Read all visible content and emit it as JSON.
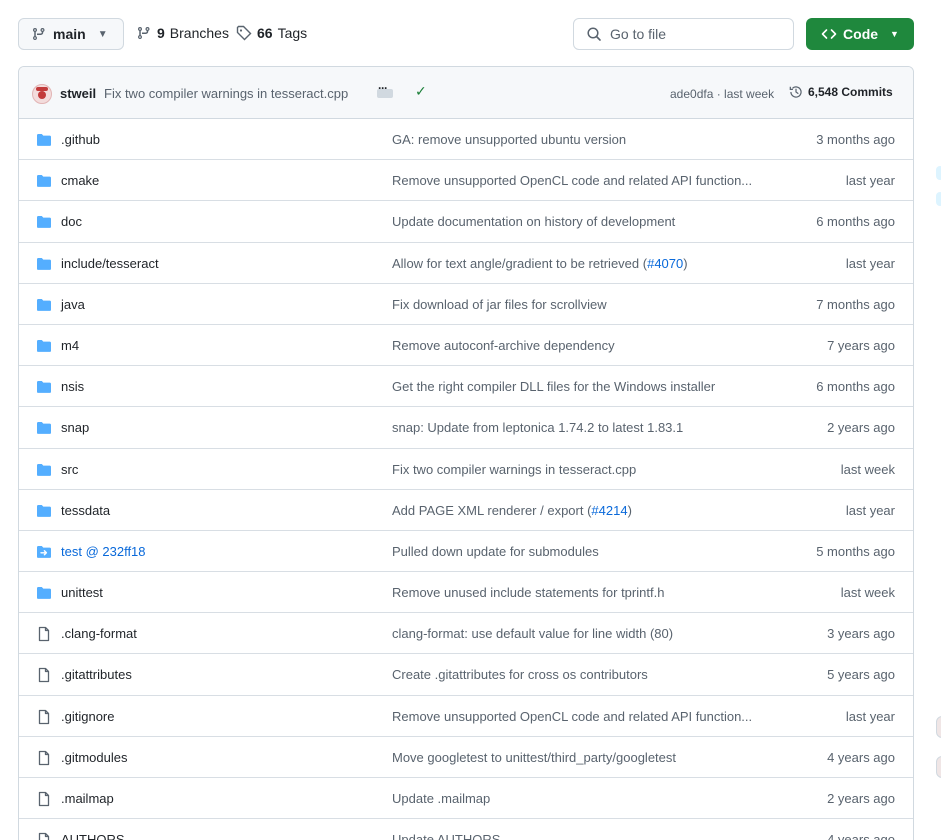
{
  "toolbar": {
    "branch": "main",
    "branches_count": "9",
    "branches_label": "Branches",
    "tags_count": "66",
    "tags_label": "Tags",
    "goto_placeholder": "Go to file",
    "code_label": "Code"
  },
  "latest_commit": {
    "author": "stweil",
    "message": "Fix two compiler warnings in tesseract.cpp",
    "hash_time": "ade0dfa · last week",
    "commits_count": "6,548 Commits"
  },
  "files": [
    {
      "name": ".github",
      "type": "folder",
      "message": "GA: remove unsupported ubuntu version",
      "message_link": "",
      "message_suffix": "",
      "time": "3 months ago"
    },
    {
      "name": "cmake",
      "type": "folder",
      "message": "Remove unsupported OpenCL code and related API function...",
      "message_link": "",
      "message_suffix": "",
      "time": "last year"
    },
    {
      "name": "doc",
      "type": "folder",
      "message": "Update documentation on history of development",
      "message_link": "",
      "message_suffix": "",
      "time": "6 months ago"
    },
    {
      "name": "include/tesseract",
      "type": "folder",
      "message": "Allow for text angle/gradient to be retrieved (",
      "message_link": "#4070",
      "message_suffix": ")",
      "time": "last year"
    },
    {
      "name": "java",
      "type": "folder",
      "message": "Fix download of jar files for scrollview",
      "message_link": "",
      "message_suffix": "",
      "time": "7 months ago"
    },
    {
      "name": "m4",
      "type": "folder",
      "message": "Remove autoconf-archive dependency",
      "message_link": "",
      "message_suffix": "",
      "time": "7 years ago"
    },
    {
      "name": "nsis",
      "type": "folder",
      "message": "Get the right compiler DLL files for the Windows installer",
      "message_link": "",
      "message_suffix": "",
      "time": "6 months ago"
    },
    {
      "name": "snap",
      "type": "folder",
      "message": "snap: Update from leptonica 1.74.2 to latest 1.83.1",
      "message_link": "",
      "message_suffix": "",
      "time": "2 years ago"
    },
    {
      "name": "src",
      "type": "folder",
      "message": "Fix two compiler warnings in tesseract.cpp",
      "message_link": "",
      "message_suffix": "",
      "time": "last week"
    },
    {
      "name": "tessdata",
      "type": "folder",
      "message": "Add PAGE XML renderer / export (",
      "message_link": "#4214",
      "message_suffix": ")",
      "time": "last year"
    },
    {
      "name": "test @ 232ff18",
      "type": "submodule",
      "message": "Pulled down update for submodules",
      "message_link": "",
      "message_suffix": "",
      "time": "5 months ago"
    },
    {
      "name": "unittest",
      "type": "folder",
      "message": "Remove unused include statements for tprintf.h",
      "message_link": "",
      "message_suffix": "",
      "time": "last week"
    },
    {
      "name": ".clang-format",
      "type": "file",
      "message": "clang-format: use default value for line width (80)",
      "message_link": "",
      "message_suffix": "",
      "time": "3 years ago"
    },
    {
      "name": ".gitattributes",
      "type": "file",
      "message": "Create .gitattributes for cross os contributors",
      "message_link": "",
      "message_suffix": "",
      "time": "5 years ago"
    },
    {
      "name": ".gitignore",
      "type": "file",
      "message": "Remove unsupported OpenCL code and related API function...",
      "message_link": "",
      "message_suffix": "",
      "time": "last year"
    },
    {
      "name": ".gitmodules",
      "type": "file",
      "message": "Move googletest to unittest/third_party/googletest",
      "message_link": "",
      "message_suffix": "",
      "time": "4 years ago"
    },
    {
      "name": ".mailmap",
      "type": "file",
      "message": "Update .mailmap",
      "message_link": "",
      "message_suffix": "",
      "time": "2 years ago"
    },
    {
      "name": "AUTHORS",
      "type": "file",
      "message": "Update AUTHORS",
      "message_link": "",
      "message_suffix": "",
      "time": "4 years ago"
    }
  ],
  "colors": {
    "folder": "#54aeff",
    "link": "#0969da",
    "code_button": "#1f883d",
    "check": "#1a7f37"
  }
}
